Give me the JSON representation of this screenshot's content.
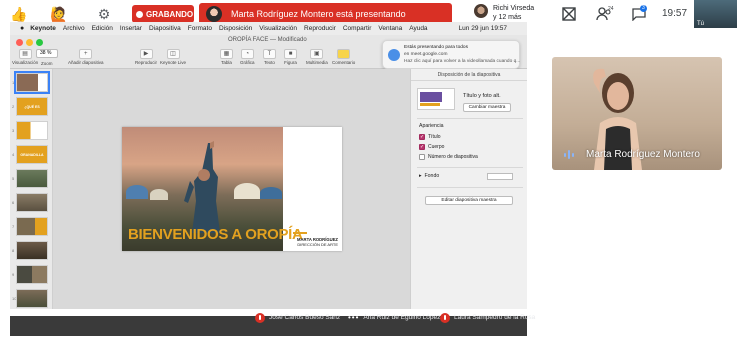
{
  "meet": {
    "recording_label": "GRABANDO",
    "presenting_label": "Marta Rodríguez Montero está presentando",
    "people_line1": "Richi Virseda",
    "people_line2": "y 12 más",
    "participants_badge": "24",
    "chat_badge": "3",
    "clock": "19:57",
    "self_label": "Tú"
  },
  "mac": {
    "menu": [
      "Keynote",
      "Archivo",
      "Edición",
      "Insertar",
      "Diapositiva",
      "Formato",
      "Disposición",
      "Visualización",
      "Reproducir",
      "Compartir",
      "Ventana",
      "Ayuda"
    ],
    "clock": "Lun 29 jun 19:57"
  },
  "keynote": {
    "doc_title": "OROPÍA FACE — Modificado",
    "zoom": "38 %",
    "tools": {
      "view": "Visualización",
      "zoom": "Zoom",
      "add_slide": "Añadir diapositiva",
      "play": "Reproducir",
      "keynote_live": "Keynote Live",
      "table": "Tabla",
      "chart": "Gráfica",
      "text": "Texto",
      "shape": "Figura",
      "media": "Multimedia",
      "comment": "Comentario"
    },
    "thumb_numbers": [
      "1",
      "2",
      "3",
      "4",
      "5",
      "6",
      "7",
      "8",
      "9",
      "10",
      "11"
    ],
    "thumb_texts": {
      "t2": "¿QUÉ ES OROPÍA?",
      "t4": "GRANADILLA"
    }
  },
  "notification": {
    "line1": "Estás presentando para todos",
    "line2": "en meet.google.com",
    "line3": "Haz clic aquí para volver a la videollamada cuando q..."
  },
  "slide": {
    "title": "BIENVENIDOS A OROPÍA",
    "name": "MARTA RODRÍGUEZ",
    "role": "DIRECCIÓN DE ARTE"
  },
  "side_panel": {
    "header": "Disposición de la diapositiva",
    "layout_name": "Título y foto alt.",
    "change_master": "Cambiar maestra",
    "appearance": "Apariencia",
    "title_cb": "Título",
    "body_cb": "Cuerpo",
    "slide_number_cb": "Número de diapositiva",
    "background": "Fondo",
    "edit_master": "Editar diapositiva maestra"
  },
  "participants": [
    {
      "name": "José Carlos Bueso Sanz"
    },
    {
      "name": "Ana Ruiz de Eguino López"
    },
    {
      "name": "Laura Sampedro de la Rosa"
    }
  ],
  "presenter": {
    "name": "Marta Rodríguez Montero"
  },
  "colors": {
    "recording_red": "#d93025",
    "slide_accent": "#e3a11f",
    "checkbox": "#b8326b"
  }
}
